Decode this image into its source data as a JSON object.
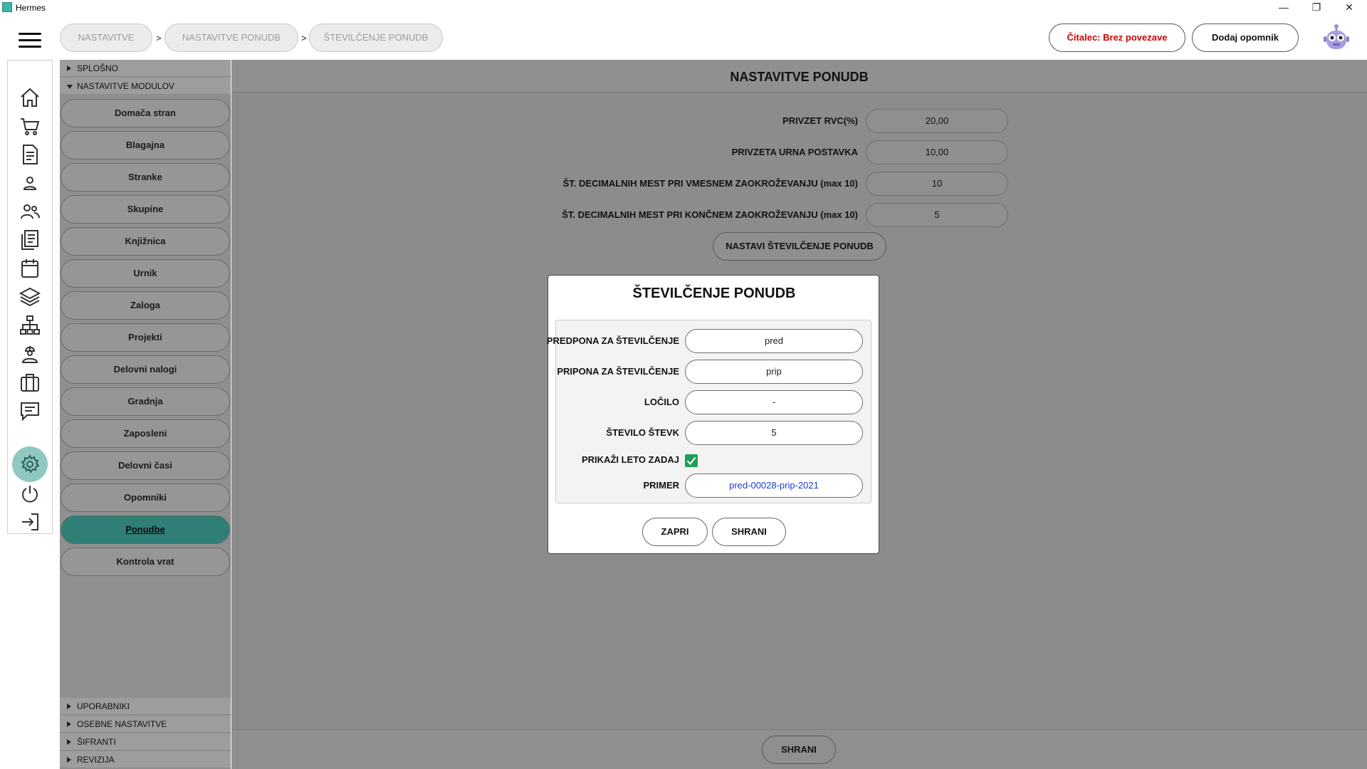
{
  "window": {
    "title": "Hermes",
    "minimize": "—",
    "restore": "❐",
    "close": "✕"
  },
  "breadcrumb": [
    {
      "label": "NASTAVITVE"
    },
    {
      "label": "NASTAVITVE PONUDB"
    },
    {
      "label": "ŠTEVILČENJE PONUDB"
    }
  ],
  "breadcrumb_separator": ">",
  "topbar": {
    "reader_status": "Čitalec: Brez povezave",
    "reader_status_color": "#d00000",
    "add_reminder": "Dodaj opomnik"
  },
  "rail_icons": [
    "home-icon",
    "cart-icon",
    "invoice-icon",
    "person-icon",
    "people-icon",
    "documents-icon",
    "calendar-icon",
    "layers-icon",
    "network-icon",
    "worker-icon",
    "briefcase-icon",
    "chat-icon",
    "gear-icon",
    "power-icon",
    "logout-icon"
  ],
  "menu": {
    "sections_top": [
      {
        "label": "SPLOŠNO",
        "expanded": false
      },
      {
        "label": "NASTAVITVE MODULOV",
        "expanded": true
      }
    ],
    "items": [
      {
        "label": "Domača stran"
      },
      {
        "label": "Blagajna"
      },
      {
        "label": "Stranke"
      },
      {
        "label": "Skupine"
      },
      {
        "label": "Knjižnica"
      },
      {
        "label": "Urnik"
      },
      {
        "label": "Zaloga"
      },
      {
        "label": "Projekti"
      },
      {
        "label": "Delovni nalogi"
      },
      {
        "label": "Gradnja"
      },
      {
        "label": "Zaposleni"
      },
      {
        "label": "Delovni časi"
      },
      {
        "label": "Opomniki"
      },
      {
        "label": "Ponudbe",
        "active": true
      },
      {
        "label": "Kontrola vrat"
      }
    ],
    "sections_bottom": [
      {
        "label": "UPORABNIKI"
      },
      {
        "label": "OSEBNE NASTAVITVE"
      },
      {
        "label": "ŠIFRANTI"
      },
      {
        "label": "REVIZIJA"
      }
    ],
    "active_color": "#2f7f77"
  },
  "main": {
    "title": "NASTAVITVE PONUDB",
    "fields": [
      {
        "label": "PRIVZET RVC(%)",
        "value": "20,00"
      },
      {
        "label": "PRIVZETA URNA POSTAVKA",
        "value": "10,00"
      },
      {
        "label": "ŠT. DECIMALNIH MEST PRI VMESNEM ZAOKROŽEVANJU (max 10)",
        "value": "10"
      },
      {
        "label": "ŠT. DECIMALNIH MEST PRI KONČNEM ZAOKROŽEVANJU (max 10)",
        "value": "5"
      }
    ],
    "numbering_button": "NASTAVI ŠTEVILČENJE PONUDB",
    "save_button": "SHRANI"
  },
  "dialog": {
    "title": "ŠTEVILČENJE PONUDB",
    "fields": [
      {
        "label": "PREDPONA ZA ŠTEVILČENJE",
        "value": "pred"
      },
      {
        "label": "PRIPONA ZA ŠTEVILČENJE",
        "value": "prip"
      },
      {
        "label": "LOČILO",
        "value": "-"
      },
      {
        "label": "ŠTEVILO ŠTEVK",
        "value": "5"
      }
    ],
    "show_year_label": "PRIKAŽI LETO ZADAJ",
    "show_year_checked": true,
    "example_label": "PRIMER",
    "example_value": "pred-00028-prip-2021",
    "close_button": "ZAPRI",
    "save_button": "SHRANI",
    "check_color": "#1e9e5a"
  }
}
